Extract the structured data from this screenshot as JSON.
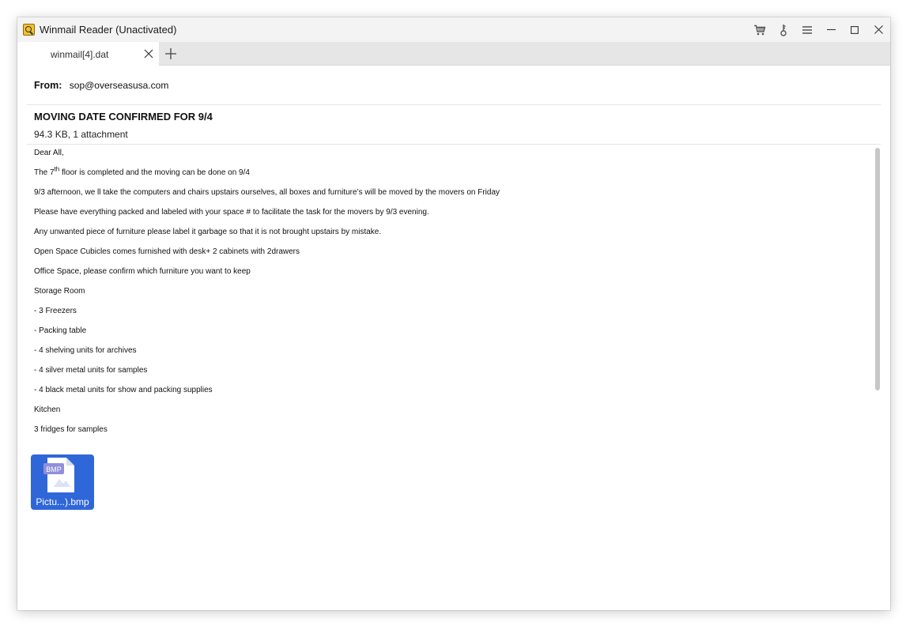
{
  "window": {
    "title": "Winmail Reader (Unactivated)"
  },
  "tabs": [
    {
      "label": "winmail[4].dat"
    }
  ],
  "email": {
    "from_label": "From:",
    "from": "sop@overseasusa.com",
    "subject": "MOVING DATE CONFIRMED FOR 9/4",
    "meta": "94.3 KB, 1 attachment",
    "body": {
      "greeting": "Dear All,",
      "line1_pre": "The 7",
      "line1_sup": "th",
      "line1_post": " floor is completed and the moving can be done on 9/4",
      "line2": "9/3 afternoon, we ll take the computers and chairs upstairs ourselves, all boxes and furniture’s will be moved by the movers on Friday",
      "line3": "Please have everything packed and labeled with your space # to facilitate the task for the movers by 9/3 evening.",
      "line4": "Any unwanted piece of furniture please label it garbage so that it is not brought upstairs by mistake.",
      "line5": "Open Space Cubicles comes furnished with desk+ 2 cabinets with 2drawers",
      "line6": "Office Space, please confirm which furniture you want to keep",
      "line7": "Storage Room",
      "line8": "- 3 Freezers",
      "line9": "- Packing table",
      "line10": "- 4 shelving units for archives",
      "line11": "- 4 silver metal units for samples",
      "line12": "- 4 black metal units for show and packing supplies",
      "line13": "Kitchen",
      "line14": "3 fridges for samples"
    },
    "attachment": {
      "type_badge": "BMP",
      "name": "Pictu...).bmp"
    }
  },
  "icons": {
    "cart": "cart-icon",
    "key": "key-icon",
    "menu": "hamburger-menu-icon",
    "minimize": "minimize-icon",
    "maximize": "maximize-icon",
    "close": "close-icon",
    "tab_close": "close-icon",
    "new_tab": "plus-icon"
  },
  "colors": {
    "attachment_bg": "#2f67d8",
    "titlebar_bg": "#f3f3f3",
    "tabbar_bg": "#e6e6e6"
  }
}
